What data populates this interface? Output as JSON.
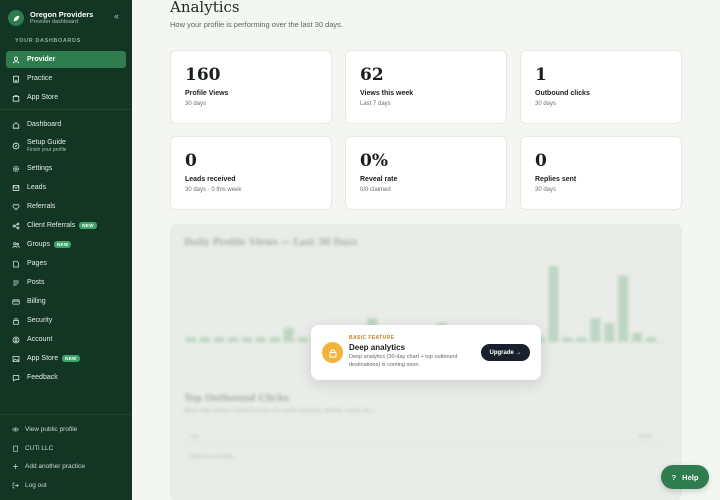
{
  "brand": {
    "title": "Oregon Providers",
    "subtitle": "Provider dashboard"
  },
  "sidebar": {
    "section_label": "YOUR DASHBOARDS",
    "dashboards": [
      {
        "label": "Provider",
        "icon": "user-icon",
        "active": true
      },
      {
        "label": "Practice",
        "icon": "building-icon"
      },
      {
        "label": "App Store",
        "icon": "store-icon"
      }
    ],
    "items": [
      {
        "label": "Dashboard",
        "icon": "home-icon"
      },
      {
        "label": "Setup Guide",
        "sub": "Finish your profile",
        "icon": "compass-icon"
      },
      {
        "label": "Settings",
        "icon": "gear-icon"
      },
      {
        "label": "Leads",
        "icon": "inbox-icon"
      },
      {
        "label": "Referrals",
        "icon": "heart-icon"
      },
      {
        "label": "Client Referrals",
        "badge": "NEW",
        "icon": "share-icon"
      },
      {
        "label": "Groups",
        "badge": "NEW",
        "icon": "users-icon"
      },
      {
        "label": "Pages",
        "icon": "page-icon"
      },
      {
        "label": "Posts",
        "icon": "list-icon"
      },
      {
        "label": "Billing",
        "icon": "card-icon"
      },
      {
        "label": "Security",
        "icon": "lock-icon"
      },
      {
        "label": "Account",
        "icon": "account-icon"
      },
      {
        "label": "App Store",
        "badge": "NEW",
        "icon": "image-icon"
      },
      {
        "label": "Feedback",
        "icon": "chat-icon"
      }
    ],
    "footer": [
      {
        "label": "View public profile",
        "icon": "eye-icon"
      },
      {
        "label": "CUTi LLC",
        "icon": "building-icon"
      },
      {
        "label": "Add another practice",
        "icon": "plus-icon"
      },
      {
        "label": "Log out",
        "icon": "logout-icon"
      }
    ]
  },
  "header": {
    "title": "Analytics",
    "subtitle": "How your profile is performing over the last 30 days."
  },
  "stats": [
    {
      "value": "160",
      "label": "Profile Views",
      "note": "30 days"
    },
    {
      "value": "62",
      "label": "Views this week",
      "note": "Last 7 days"
    },
    {
      "value": "1",
      "label": "Outbound clicks",
      "note": "30 days"
    },
    {
      "value": "0",
      "label": "Leads received",
      "note": "30 days · 0 this week"
    },
    {
      "value": "0%",
      "label": "Reveal rate",
      "note": "0/0 claimed"
    },
    {
      "value": "0",
      "label": "Replies sent",
      "note": "30 days"
    }
  ],
  "locked": {
    "chart_title": "Daily Profile Views — Last 30 Days",
    "bottom_title": "Top Outbound Clicks",
    "bottom_subtitle": "Which links visitors clicked to leave your profile (booking, website, social, etc.)",
    "col_link": "Link",
    "col_clicks": "Clicks",
    "empty_row": "https://cuti.example...",
    "overlay": {
      "kicker": "BASIC FEATURE",
      "title": "Deep analytics",
      "description": "Deep analytics (30-day chart + top outbound destinations) is coming soon.",
      "button": "Upgrade →"
    }
  },
  "chart_data": {
    "type": "bar",
    "title": "Daily Profile Views — Last 30 Days",
    "values": [
      1,
      1,
      1,
      1,
      1,
      1,
      1,
      1,
      1,
      1,
      1,
      1,
      1,
      1,
      3,
      1,
      1,
      1,
      1,
      1,
      1,
      1,
      5,
      1,
      1,
      1,
      1,
      1,
      1,
      1,
      4,
      1,
      1,
      1,
      1,
      1,
      1,
      1,
      1,
      1,
      1,
      1,
      1,
      1,
      1,
      1,
      1,
      1,
      1,
      1,
      1,
      1,
      1,
      1,
      1,
      1,
      1,
      1,
      1,
      1
    ],
    "series_note": "",
    "blurred": true
  },
  "chart_bars": [
    1,
    1,
    1,
    1,
    1,
    1,
    1,
    3,
    1,
    1,
    1,
    1,
    1,
    5,
    1,
    1,
    1,
    1,
    4,
    1,
    1,
    1,
    1,
    1,
    1,
    1,
    16,
    1,
    1,
    5,
    4,
    14,
    2,
    1
  ],
  "help": {
    "label": "Help",
    "icon": "question-icon"
  },
  "colors": {
    "sidebar": "#123524",
    "accent": "#2f7d4e",
    "bar": "#9cc4a6"
  }
}
